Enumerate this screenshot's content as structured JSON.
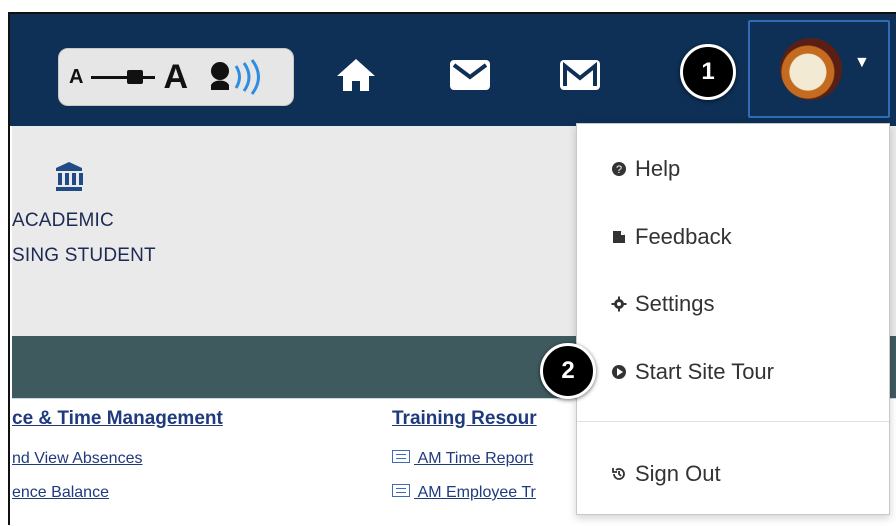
{
  "toolbar": {
    "small_text_label": "A",
    "large_text_label": "A"
  },
  "callouts": {
    "one": "1",
    "two": "2"
  },
  "content": {
    "lines": [
      "ACADEMIC",
      "SING STUDENT"
    ]
  },
  "links": {
    "left_heading": "ce & Time Management",
    "left_items": [
      "nd View Absences",
      "ence Balance"
    ],
    "right_heading": "Training Resour",
    "right_items": [
      "AM Time Report",
      "AM Employee Tr"
    ]
  },
  "dropdown": {
    "help": "Help",
    "feedback": "Feedback",
    "settings": "Settings",
    "tour": "Start Site Tour",
    "signout": "Sign Out"
  }
}
